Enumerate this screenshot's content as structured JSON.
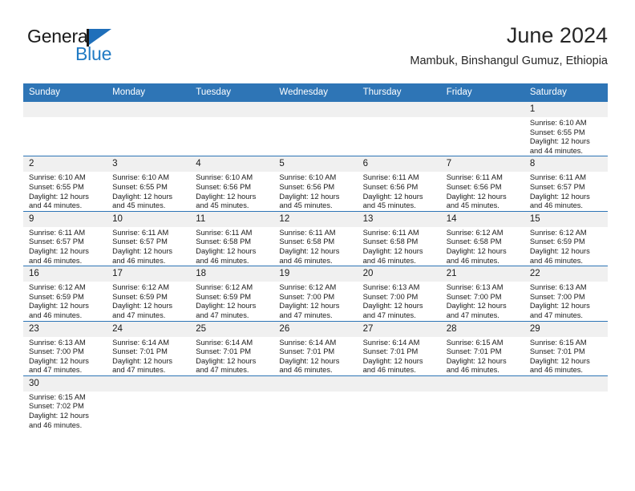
{
  "brand": {
    "word_one": "General",
    "word_two": "Blue",
    "flag_icon": "blue-triangle-flag-icon",
    "colors": {
      "flag_blue": "#1f6fba",
      "text_blue": "#1f7ac4",
      "text_dark": "#1a1a1a"
    }
  },
  "header": {
    "title": "June 2024",
    "subtitle": "Mambuk, Binshangul Gumuz, Ethiopia"
  },
  "theme": {
    "header_blue": "#2e75b6",
    "daynum_gray": "#f0f0f0",
    "cell_white": "#ffffff"
  },
  "calendar": {
    "weekdays": [
      "Sunday",
      "Monday",
      "Tuesday",
      "Wednesday",
      "Thursday",
      "Friday",
      "Saturday"
    ],
    "weeks": [
      [
        {
          "day": "",
          "lines": []
        },
        {
          "day": "",
          "lines": []
        },
        {
          "day": "",
          "lines": []
        },
        {
          "day": "",
          "lines": []
        },
        {
          "day": "",
          "lines": []
        },
        {
          "day": "",
          "lines": []
        },
        {
          "day": "1",
          "lines": [
            "Sunrise: 6:10 AM",
            "Sunset: 6:55 PM",
            "Daylight: 12 hours",
            "and 44 minutes."
          ]
        }
      ],
      [
        {
          "day": "2",
          "lines": [
            "Sunrise: 6:10 AM",
            "Sunset: 6:55 PM",
            "Daylight: 12 hours",
            "and 44 minutes."
          ]
        },
        {
          "day": "3",
          "lines": [
            "Sunrise: 6:10 AM",
            "Sunset: 6:55 PM",
            "Daylight: 12 hours",
            "and 45 minutes."
          ]
        },
        {
          "day": "4",
          "lines": [
            "Sunrise: 6:10 AM",
            "Sunset: 6:56 PM",
            "Daylight: 12 hours",
            "and 45 minutes."
          ]
        },
        {
          "day": "5",
          "lines": [
            "Sunrise: 6:10 AM",
            "Sunset: 6:56 PM",
            "Daylight: 12 hours",
            "and 45 minutes."
          ]
        },
        {
          "day": "6",
          "lines": [
            "Sunrise: 6:11 AM",
            "Sunset: 6:56 PM",
            "Daylight: 12 hours",
            "and 45 minutes."
          ]
        },
        {
          "day": "7",
          "lines": [
            "Sunrise: 6:11 AM",
            "Sunset: 6:56 PM",
            "Daylight: 12 hours",
            "and 45 minutes."
          ]
        },
        {
          "day": "8",
          "lines": [
            "Sunrise: 6:11 AM",
            "Sunset: 6:57 PM",
            "Daylight: 12 hours",
            "and 46 minutes."
          ]
        }
      ],
      [
        {
          "day": "9",
          "lines": [
            "Sunrise: 6:11 AM",
            "Sunset: 6:57 PM",
            "Daylight: 12 hours",
            "and 46 minutes."
          ]
        },
        {
          "day": "10",
          "lines": [
            "Sunrise: 6:11 AM",
            "Sunset: 6:57 PM",
            "Daylight: 12 hours",
            "and 46 minutes."
          ]
        },
        {
          "day": "11",
          "lines": [
            "Sunrise: 6:11 AM",
            "Sunset: 6:58 PM",
            "Daylight: 12 hours",
            "and 46 minutes."
          ]
        },
        {
          "day": "12",
          "lines": [
            "Sunrise: 6:11 AM",
            "Sunset: 6:58 PM",
            "Daylight: 12 hours",
            "and 46 minutes."
          ]
        },
        {
          "day": "13",
          "lines": [
            "Sunrise: 6:11 AM",
            "Sunset: 6:58 PM",
            "Daylight: 12 hours",
            "and 46 minutes."
          ]
        },
        {
          "day": "14",
          "lines": [
            "Sunrise: 6:12 AM",
            "Sunset: 6:58 PM",
            "Daylight: 12 hours",
            "and 46 minutes."
          ]
        },
        {
          "day": "15",
          "lines": [
            "Sunrise: 6:12 AM",
            "Sunset: 6:59 PM",
            "Daylight: 12 hours",
            "and 46 minutes."
          ]
        }
      ],
      [
        {
          "day": "16",
          "lines": [
            "Sunrise: 6:12 AM",
            "Sunset: 6:59 PM",
            "Daylight: 12 hours",
            "and 46 minutes."
          ]
        },
        {
          "day": "17",
          "lines": [
            "Sunrise: 6:12 AM",
            "Sunset: 6:59 PM",
            "Daylight: 12 hours",
            "and 47 minutes."
          ]
        },
        {
          "day": "18",
          "lines": [
            "Sunrise: 6:12 AM",
            "Sunset: 6:59 PM",
            "Daylight: 12 hours",
            "and 47 minutes."
          ]
        },
        {
          "day": "19",
          "lines": [
            "Sunrise: 6:12 AM",
            "Sunset: 7:00 PM",
            "Daylight: 12 hours",
            "and 47 minutes."
          ]
        },
        {
          "day": "20",
          "lines": [
            "Sunrise: 6:13 AM",
            "Sunset: 7:00 PM",
            "Daylight: 12 hours",
            "and 47 minutes."
          ]
        },
        {
          "day": "21",
          "lines": [
            "Sunrise: 6:13 AM",
            "Sunset: 7:00 PM",
            "Daylight: 12 hours",
            "and 47 minutes."
          ]
        },
        {
          "day": "22",
          "lines": [
            "Sunrise: 6:13 AM",
            "Sunset: 7:00 PM",
            "Daylight: 12 hours",
            "and 47 minutes."
          ]
        }
      ],
      [
        {
          "day": "23",
          "lines": [
            "Sunrise: 6:13 AM",
            "Sunset: 7:00 PM",
            "Daylight: 12 hours",
            "and 47 minutes."
          ]
        },
        {
          "day": "24",
          "lines": [
            "Sunrise: 6:14 AM",
            "Sunset: 7:01 PM",
            "Daylight: 12 hours",
            "and 47 minutes."
          ]
        },
        {
          "day": "25",
          "lines": [
            "Sunrise: 6:14 AM",
            "Sunset: 7:01 PM",
            "Daylight: 12 hours",
            "and 47 minutes."
          ]
        },
        {
          "day": "26",
          "lines": [
            "Sunrise: 6:14 AM",
            "Sunset: 7:01 PM",
            "Daylight: 12 hours",
            "and 46 minutes."
          ]
        },
        {
          "day": "27",
          "lines": [
            "Sunrise: 6:14 AM",
            "Sunset: 7:01 PM",
            "Daylight: 12 hours",
            "and 46 minutes."
          ]
        },
        {
          "day": "28",
          "lines": [
            "Sunrise: 6:15 AM",
            "Sunset: 7:01 PM",
            "Daylight: 12 hours",
            "and 46 minutes."
          ]
        },
        {
          "day": "29",
          "lines": [
            "Sunrise: 6:15 AM",
            "Sunset: 7:01 PM",
            "Daylight: 12 hours",
            "and 46 minutes."
          ]
        }
      ],
      [
        {
          "day": "30",
          "lines": [
            "Sunrise: 6:15 AM",
            "Sunset: 7:02 PM",
            "Daylight: 12 hours",
            "and 46 minutes."
          ]
        },
        {
          "day": "",
          "lines": []
        },
        {
          "day": "",
          "lines": []
        },
        {
          "day": "",
          "lines": []
        },
        {
          "day": "",
          "lines": []
        },
        {
          "day": "",
          "lines": []
        },
        {
          "day": "",
          "lines": []
        }
      ]
    ]
  }
}
